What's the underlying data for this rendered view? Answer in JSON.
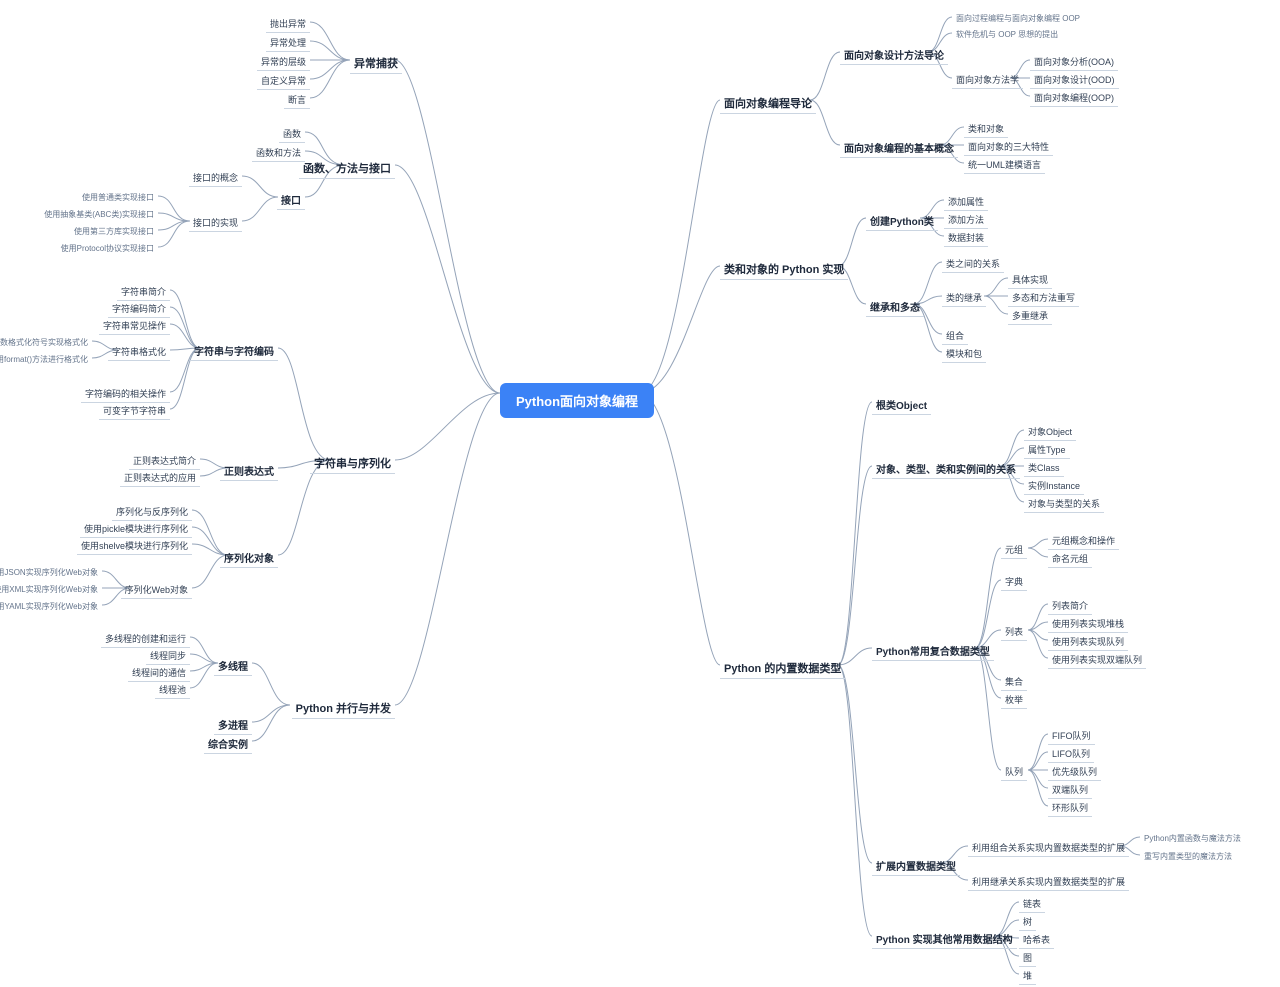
{
  "root": "Python面向对象编程",
  "L": {
    "b1": {
      "label": "异常捕获",
      "children": [
        "抛出异常",
        "异常处理",
        "异常的层级",
        "自定义异常",
        "断言"
      ]
    },
    "b2": {
      "label": "函数、方法与接口",
      "c1": "函数",
      "c2": "函数和方法",
      "c3": {
        "label": "接口",
        "g1": "接口的概念",
        "g2": {
          "label": "接口的实现",
          "leaves": [
            "使用普通类实现接口",
            "使用抽象基类(ABC类)实现接口",
            "使用第三方库实现接口",
            "使用Protocol协议实现接口"
          ]
        }
      }
    },
    "b3": {
      "label": "字符串与序列化",
      "s1": {
        "label": "字符串与字符编码",
        "leaves": [
          "字符串简介",
          "字符编码简介",
          "字符串常见操作"
        ],
        "fmt": {
          "label": "字符串格式化",
          "leaves": [
            "使用Print函数格式化符号实现格式化",
            "使用format()方法进行格式化"
          ]
        },
        "tail": [
          "字符编码的相关操作",
          "可变字节字符串"
        ]
      },
      "s2": {
        "label": "正则表达式",
        "leaves": [
          "正则表达式简介",
          "正则表达式的应用"
        ]
      },
      "s3": {
        "label": "序列化对象",
        "leaves": [
          "序列化与反序列化",
          "使用pickle模块进行序列化",
          "使用shelve模块进行序列化"
        ],
        "web": {
          "label": "序列化Web对象",
          "leaves": [
            "使用JSON实现序列化Web对象",
            "使用XML实现序列化Web对象",
            "使用YAML实现序列化Web对象"
          ]
        }
      }
    },
    "b4": {
      "label": "Python 并行与并发",
      "c1": {
        "label": "多线程",
        "leaves": [
          "多线程的创建和运行",
          "线程同步",
          "线程间的通信",
          "线程池"
        ]
      },
      "c2": "多进程",
      "c3": "综合实例"
    }
  },
  "R": {
    "b1": {
      "label": "面向对象编程导论",
      "s1": {
        "label": "面向对象设计方法导论",
        "t1": "面向过程编程与面向对象编程 OOP",
        "t2": "软件危机与 OOP 思想的提出",
        "t3": {
          "label": "面向对象方法学",
          "leaves": [
            "面向对象分析(OOA)",
            "面向对象设计(OOD)",
            "面向对象编程(OOP)"
          ]
        }
      },
      "s2": {
        "label": "面向对象编程的基本概念",
        "leaves": [
          "类和对象",
          "面向对象的三大特性",
          "统一UML建模语言"
        ]
      }
    },
    "b2": {
      "label": "类和对象的 Python 实现",
      "s1": {
        "label": "创建Python类",
        "leaves": [
          "添加属性",
          "添加方法",
          "数据封装"
        ]
      },
      "s2": {
        "label": "继承和多态",
        "g1": "类之间的关系",
        "g2": {
          "label": "类的继承",
          "leaves": [
            "具体实现",
            "多态和方法重写",
            "多重继承"
          ]
        },
        "g3": "组合",
        "g4": "模块和包"
      }
    },
    "b3": {
      "label": "Python 的内置数据类型",
      "s1": "根类Object",
      "s2": {
        "label": "对象、类型、类和实例间的关系",
        "leaves": [
          "对象Object",
          "属性Type",
          "类Class",
          "实例Instance",
          "对象与类型的关系"
        ]
      },
      "s3": {
        "label": "Python常用复合数据类型",
        "g1": {
          "label": "元组",
          "leaves": [
            "元组概念和操作",
            "命名元组"
          ]
        },
        "g2": "字典",
        "g3": {
          "label": "列表",
          "leaves": [
            "列表简介",
            "使用列表实现堆栈",
            "使用列表实现队列",
            "使用列表实现双端队列"
          ]
        },
        "g4": "集合",
        "g5": "枚举",
        "g6": {
          "label": "队列",
          "leaves": [
            "FIFO队列",
            "LIFO队列",
            "优先级队列",
            "双端队列",
            "环形队列"
          ]
        }
      },
      "s4": {
        "label": "扩展内置数据类型",
        "g1": {
          "label": "利用组合关系实现内置数据类型的扩展",
          "leaves": [
            "Python内置函数与魔法方法",
            "重写内置类型的魔法方法"
          ]
        },
        "g2": "利用继承关系实现内置数据类型的扩展"
      },
      "s5": {
        "label": "Python 实现其他常用数据结构",
        "leaves": [
          "链表",
          "树",
          "哈希表",
          "图",
          "堆"
        ]
      }
    }
  }
}
